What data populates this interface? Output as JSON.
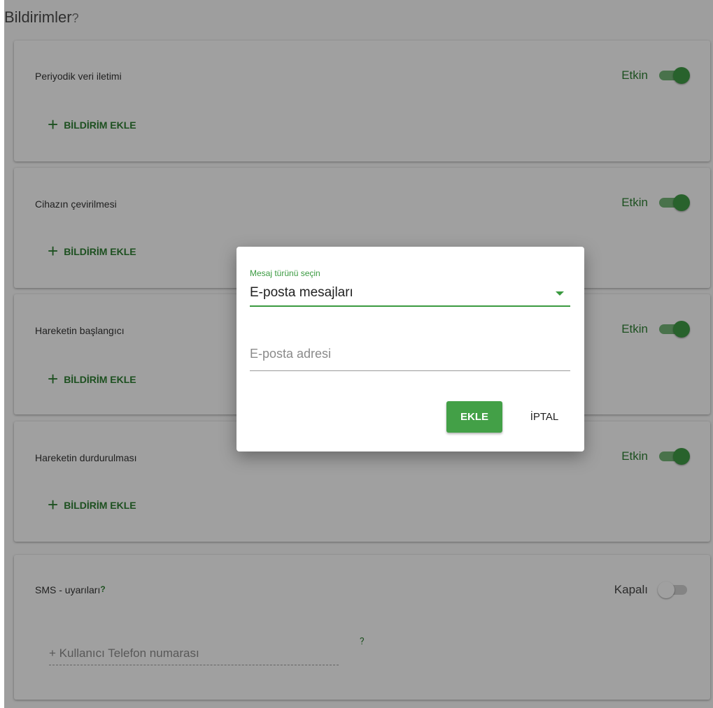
{
  "page": {
    "title": "Bildirimler",
    "title_help": "?"
  },
  "cards": [
    {
      "title": "Periyodik veri iletimi",
      "status": "Etkin",
      "on": true,
      "add_label": "BİLDİRİM EKLE"
    },
    {
      "title": "Cihazın çevirilmesi",
      "status": "Etkin",
      "on": true,
      "add_label": "BİLDİRİM EKLE"
    },
    {
      "title": "Hareketin başlangıcı",
      "status": "Etkin",
      "on": true,
      "add_label": "BİLDİRİM EKLE"
    },
    {
      "title": "Hareketin durdurulması",
      "status": "Etkin",
      "on": true,
      "add_label": "BİLDİRİM EKLE"
    }
  ],
  "sms": {
    "title": "SMS - uyarıları",
    "help": "?",
    "status": "Kapalı",
    "on": false,
    "phone_placeholder": "+ Kullanıcı Telefon numarası",
    "phone_help": "?"
  },
  "dialog": {
    "type_label": "Mesaj türünü seçin",
    "type_value": "E-posta mesajları",
    "email_placeholder": "E-posta adresi",
    "add_button": "EKLE",
    "cancel_button": "İPTAL"
  },
  "colors": {
    "accent": "#43a047",
    "accent_text": "#2e7d32"
  },
  "icons": {
    "add": "plus-icon",
    "dropdown": "caret-down-icon"
  }
}
